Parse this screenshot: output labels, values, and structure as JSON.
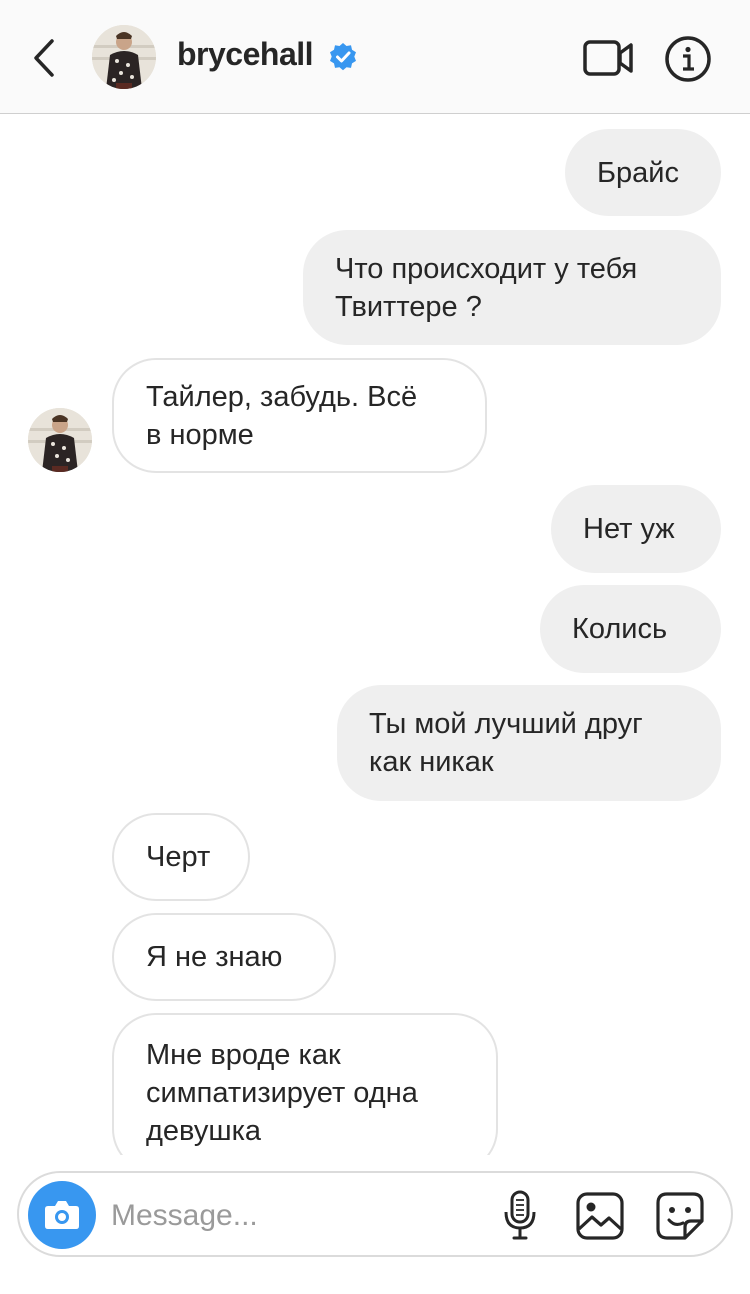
{
  "header": {
    "username": "brycehall",
    "back_icon": "chevron-left-icon",
    "verified_icon": "verified-badge-icon",
    "video_icon": "video-camera-icon",
    "info_icon": "info-circle-icon"
  },
  "messages": [
    {
      "sender": "me",
      "text": "Брайс"
    },
    {
      "sender": "me",
      "text": "Что происходит у тебя\nТвиттере ?"
    },
    {
      "sender": "bryce",
      "text": "Тайлер, забудь. Всё\nв норме"
    },
    {
      "sender": "me",
      "text": "Нет уж"
    },
    {
      "sender": "me",
      "text": "Колись"
    },
    {
      "sender": "me",
      "text": "Ты мой лучший друг\nкак никак"
    },
    {
      "sender": "bryce",
      "text": "Черт"
    },
    {
      "sender": "bryce",
      "text": "Я не знаю"
    },
    {
      "sender": "bryce",
      "text": "Мне вроде как\nсимпатизирует одна\nдевушка"
    }
  ],
  "composer": {
    "placeholder": "Message...",
    "camera_icon": "camera-icon",
    "mic_icon": "microphone-icon",
    "gallery_icon": "image-gallery-icon",
    "sticker_icon": "sticker-icon"
  },
  "colors": {
    "accent": "#3897f0",
    "verified": "#3897f0",
    "outgoing_bubble": "#efefef",
    "incoming_border": "#e3e3e3",
    "text": "#262626"
  }
}
